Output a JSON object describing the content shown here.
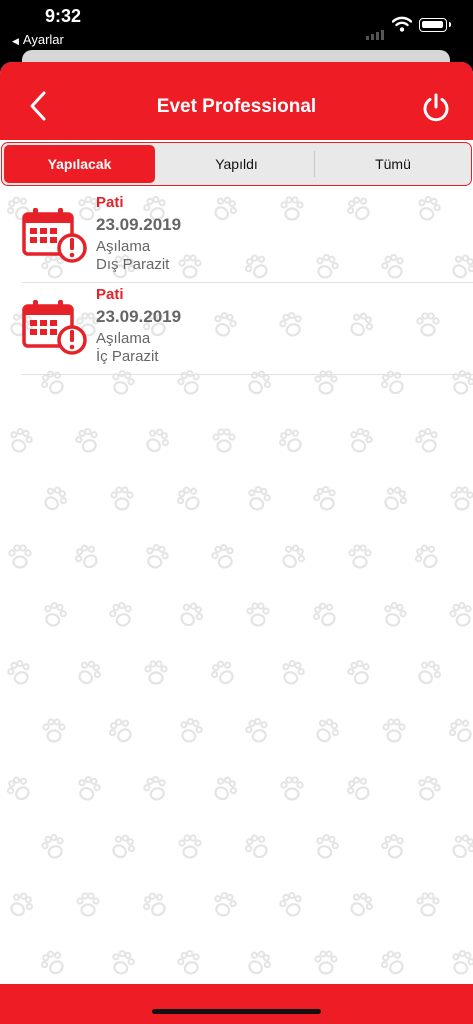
{
  "status_bar": {
    "time": "9:32",
    "back_app": "Ayarlar",
    "back_icon": "triangle-left-icon",
    "icons": [
      "cellular-signal-icon",
      "wifi-icon",
      "battery-icon"
    ]
  },
  "navbar": {
    "title": "Evet Professional",
    "back_icon": "chevron-left-icon",
    "power_icon": "power-icon"
  },
  "tabs": {
    "items": [
      {
        "label": "Yapılacak",
        "selected": true
      },
      {
        "label": "Yapıldı",
        "selected": false
      },
      {
        "label": "Tümü",
        "selected": false
      }
    ]
  },
  "tasks": [
    {
      "name": "Pati",
      "date": "23.09.2019",
      "type": "Aşılama",
      "subtype": "Dış Parazit",
      "icon": "calendar-alert-icon"
    },
    {
      "name": "Pati",
      "date": "23.09.2019",
      "type": "Aşılama",
      "subtype": "İç Parazit",
      "icon": "calendar-alert-icon"
    }
  ],
  "colors": {
    "brand_red": "#ee1c25",
    "text_gray": "#666666",
    "pattern_gray": "#e6e6e6"
  },
  "background_icon": "paw-print-icon"
}
